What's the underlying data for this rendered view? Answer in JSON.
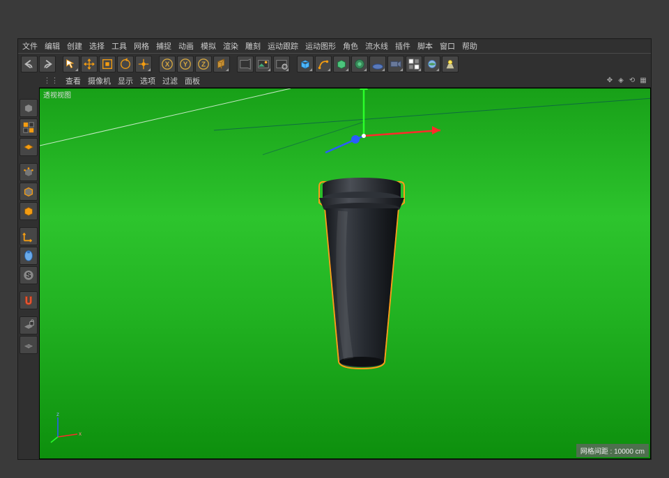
{
  "menu": [
    "文件",
    "编辑",
    "创建",
    "选择",
    "工具",
    "网格",
    "捕捉",
    "动画",
    "模拟",
    "渲染",
    "雕刻",
    "运动跟踪",
    "运动图形",
    "角色",
    "流水线",
    "插件",
    "脚本",
    "窗口",
    "帮助"
  ],
  "viewportMenu": [
    "查看",
    "摄像机",
    "显示",
    "选项",
    "过滤",
    "面板"
  ],
  "viewportLabel": "透视视图",
  "statusBar": "网格间距 : 10000 cm",
  "miniAxis": {
    "x": "x",
    "z": "z"
  },
  "toolbarIcons": [
    "undo",
    "redo",
    "select",
    "move",
    "scale",
    "rotate",
    "recent",
    "x-axis",
    "y-axis",
    "z-axis",
    "coord",
    "render",
    "render-region",
    "render-settings",
    "cube",
    "pen",
    "deformer",
    "environment",
    "camera",
    "light",
    "tag",
    "grid",
    "spotlight"
  ],
  "leftIcons": [
    "editable",
    "points",
    "edges",
    "polys",
    "model",
    "axis",
    "mouse",
    "snap",
    "magnet",
    "lock",
    "workplane"
  ],
  "colors": {
    "accent_orange": "#f39c12",
    "axis_x": "#ff2a2a",
    "axis_y": "#2aff2a",
    "axis_z": "#2a5cff"
  }
}
